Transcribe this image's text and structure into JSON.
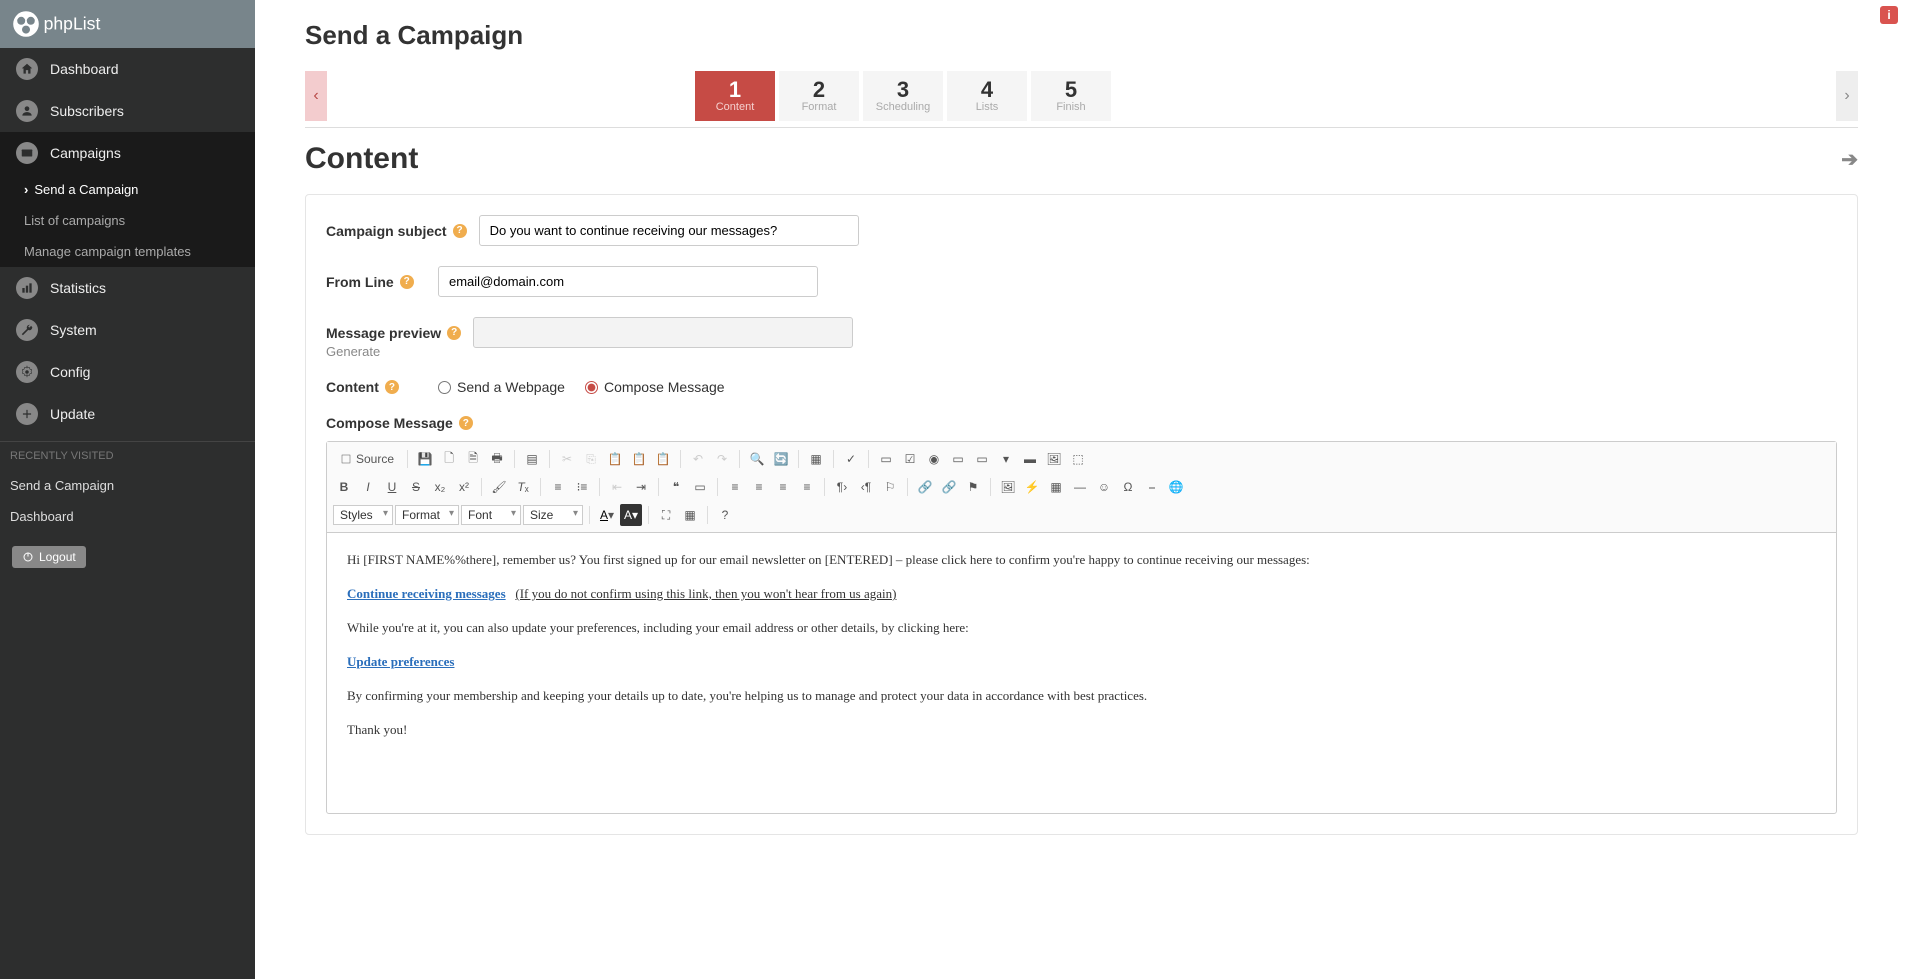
{
  "brand": "phpList",
  "sidebar": {
    "items": [
      {
        "label": "Dashboard",
        "icon": "home"
      },
      {
        "label": "Subscribers",
        "icon": "user"
      },
      {
        "label": "Campaigns",
        "icon": "mail"
      },
      {
        "label": "Statistics",
        "icon": "chart"
      },
      {
        "label": "System",
        "icon": "wrench"
      },
      {
        "label": "Config",
        "icon": "gear"
      },
      {
        "label": "Update",
        "icon": "plus"
      }
    ],
    "subnav": [
      {
        "label": "Send a Campaign",
        "active": true
      },
      {
        "label": "List of campaigns"
      },
      {
        "label": "Manage campaign templates"
      }
    ],
    "recent_label": "RECENTLY VISITED",
    "recent": [
      {
        "label": "Send a Campaign"
      },
      {
        "label": "Dashboard"
      }
    ],
    "logout": "Logout"
  },
  "page": {
    "title": "Send a Campaign",
    "section_title": "Content"
  },
  "steps": [
    {
      "num": "1",
      "label": "Content",
      "active": true
    },
    {
      "num": "2",
      "label": "Format"
    },
    {
      "num": "3",
      "label": "Scheduling"
    },
    {
      "num": "4",
      "label": "Lists"
    },
    {
      "num": "5",
      "label": "Finish"
    }
  ],
  "form": {
    "subject_label": "Campaign subject",
    "subject_value": "Do you want to continue receiving our messages?",
    "from_label": "From Line",
    "from_value": "email@domain.com",
    "preview_label": "Message preview",
    "preview_value": "",
    "generate": "Generate",
    "content_label": "Content",
    "content_opt1": "Send a Webpage",
    "content_opt2": "Compose Message",
    "compose_label": "Compose Message"
  },
  "editor": {
    "source": "Source",
    "dropdowns": {
      "styles": "Styles",
      "format": "Format",
      "font": "Font",
      "size": "Size"
    },
    "body": {
      "p1": "Hi [FIRST NAME%%there], remember us? You first signed up for our email newsletter on [ENTERED] – please click here to confirm you're happy to continue receiving our messages:",
      "link1": "Continue receiving messages",
      "note1": "(If you do not confirm using this link, then you won't hear from us again)",
      "p2": "While you're at it, you can also update your preferences, including your email address or other details, by clicking here:",
      "link2": "Update preferences",
      "p3": "By confirming your membership and keeping your details up to date, you're helping us to manage and protect your data in accordance with best practices.",
      "p4": "Thank you!"
    }
  }
}
